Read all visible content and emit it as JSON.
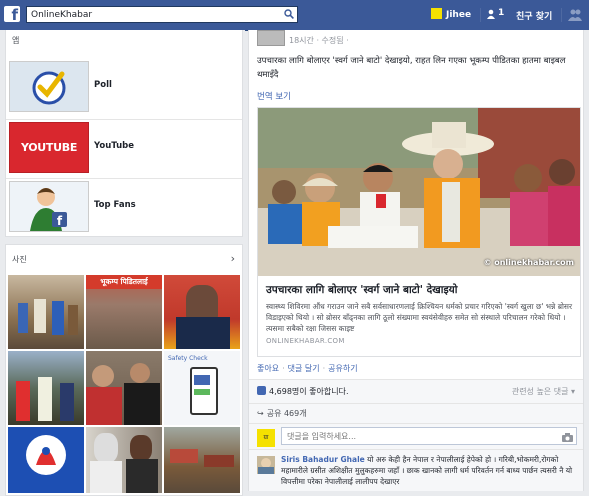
{
  "topbar": {
    "logo": "f",
    "search_value": "OnlineKhabar",
    "user_name": "Jihee",
    "friend_requests": "1",
    "find_friends": "친구 찾기",
    "icons": [
      "facebook-logo-icon",
      "search-icon",
      "friends-icon",
      "people-icon"
    ]
  },
  "apps": {
    "title": "앱",
    "items": [
      {
        "label": "Poll"
      },
      {
        "label": "YouTube",
        "thumb_text": "YOUTUBE TAB"
      },
      {
        "label": "Top Fans"
      }
    ]
  },
  "photos": {
    "title": "사진",
    "tile_text": "भूकम्प पिडितलाई",
    "card_text": "Safety Check"
  },
  "post": {
    "time": "18시간 · 수정됨 ·",
    "text": "उपचारका लागि बोलाएर 'स्वर्ग जाने बाटो' देखाइयो, राहत लिन गएका भूकम्प पीडितका हातमा बाइबल थमाइँदै",
    "see_translation": "번역 보기",
    "article": {
      "title": "उपचारका लागि बोलाएर 'स्वर्ग जाने बाटो' देखाइयो",
      "description": "स्वास्थ्य शिविरमा औंध गराउन जाने सबै सर्वसाधारणलाई क्रिश्चियन धर्मको प्रचार गरिएको 'स्वर्ग खुला छ' भन्ने ब्रोसर विडाइएको थियो । सो ब्रोसर बाँढ्नका लागि ठूलो संख्यामा स्वयंसेवीहरु समेत सो संस्थाले परिचालन गरेको थियो । त्यसमा सबैको रक्षा जिसस काइष्ट",
      "source": "ONLINEKHABAR.COM",
      "watermark": "© onlinekhabar.com"
    },
    "actions": [
      "좋아요",
      "댓글 달기",
      "공유하기"
    ],
    "likes": "4,698명이 좋아합니다.",
    "relevance": "관련성 높은 댓글 ▾",
    "shares": "공유 469개",
    "comment_avatar": "ग्रा",
    "comment_placeholder": "댓글을 입력하세요...",
    "first_comment": {
      "author": "Siris Bahadur Ghale",
      "text": "यो अरु केही हैन नेपाल र नेपालीलाई हेपेको हो । गरिबी,भोकमरी,रोगको महामारीले ग्रसीत अशिक्षीत मुलुकहरुमा जहाँ । छाक खानको लागी धर्म परिवर्तन गर्न बाध्य पार्छन त्यसरी नै यो विपत्तीमा परेका नेपालीलाई लालीपप देखाएर"
    }
  },
  "colors": {
    "brand": "#3b5998",
    "link": "#4267b2",
    "youtube_red": "#d9272e"
  }
}
